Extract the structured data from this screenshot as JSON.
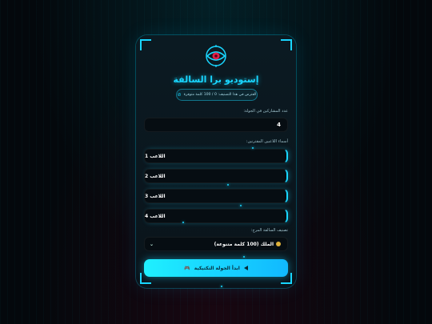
{
  "app": {
    "title": "إستوديو برا السالفة",
    "pill_text": "الفترض في هذا التصنيف: 0 / 100 كلمة متوفرة"
  },
  "form": {
    "count_label": "عدد المشاركين في الجولة:",
    "count_value": "4",
    "players_label": "أسماء اللاعبين المقترنين:",
    "players": [
      "اللاعب 1",
      "اللاعب 2",
      "اللاعب 3",
      "اللاعب 4"
    ],
    "category_label": "تصنيف السالفة المرح:",
    "category_value": "الملك (100 كلمة متنوعة)",
    "start_label": "ابدأ الجولة التكتيكية"
  },
  "colors": {
    "accent": "#19d6ff",
    "logo_core": "#e2204a"
  }
}
